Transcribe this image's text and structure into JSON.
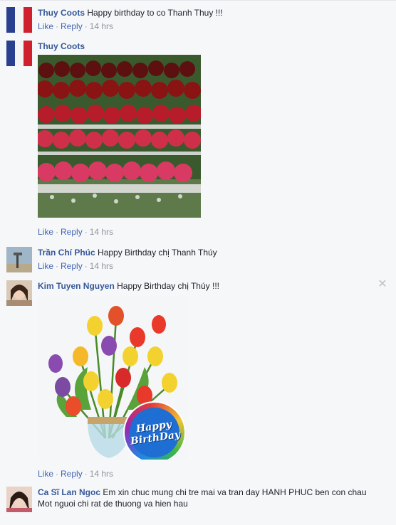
{
  "comments": [
    {
      "author": "Thuy Coots",
      "text": "Happy birthday to co Thanh Thuy !!!",
      "like": "Like",
      "reply": "Reply",
      "time": "14 hrs"
    },
    {
      "author": "Thuy Coots",
      "text": "",
      "like": "Like",
      "reply": "Reply",
      "time": "14 hrs",
      "image": "red-roses-photo"
    },
    {
      "author": "Trần Chí Phúc",
      "text": "Happy Birthday chị Thanh Thúy",
      "like": "Like",
      "reply": "Reply",
      "time": "14 hrs"
    },
    {
      "author": "Kim Tuyen Nguyen",
      "text": "Happy Birthday chị Thúy !!!",
      "like": "Like",
      "reply": "Reply",
      "time": "14 hrs",
      "image": "tulip-bouquet-photo",
      "balloon_line1": "Happy",
      "balloon_line2": "BirthDay"
    },
    {
      "author": "Ca Sĩ Lan Ngoc",
      "text": "Em xin chuc mung chi tre mai va tran day HANH PHUC ben con chau",
      "text2": "Mot nguoi chi rat de thuong va hien hau"
    }
  ],
  "close_icon": "close-icon",
  "separator": "·"
}
